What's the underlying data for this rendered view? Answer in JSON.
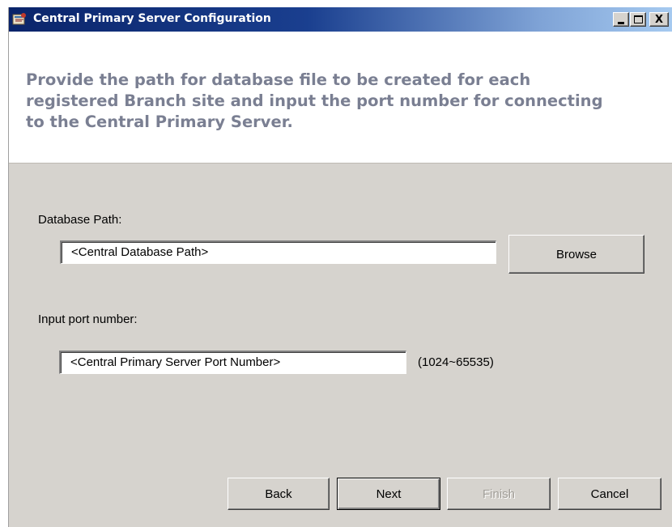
{
  "window": {
    "title": "Central Primary Server Configuration",
    "icon": "wizard-app-icon",
    "controls": {
      "minimize": "minimize-icon",
      "maximize": "maximize-icon",
      "close_label": "X"
    }
  },
  "header": {
    "instruction": "Provide the path for database file to be created for each registered Branch site and input the port number for connecting to the Central Primary Server."
  },
  "form": {
    "database_path": {
      "label": "Database Path:",
      "value": "<Central Database Path>",
      "browse_label": "Browse"
    },
    "port": {
      "label": "Input port number:",
      "value": "<Central Primary Server Port Number>",
      "range_hint": "(1024~65535)"
    }
  },
  "buttons": {
    "back": "Back",
    "next": "Next",
    "finish": "Finish",
    "cancel": "Cancel"
  },
  "colors": {
    "titlebar_start": "#0a246a",
    "titlebar_end": "#a6caf0",
    "header_text": "#7a7f92",
    "dialog_bg": "#d6d3ce",
    "disabled_text": "#a19e98"
  }
}
